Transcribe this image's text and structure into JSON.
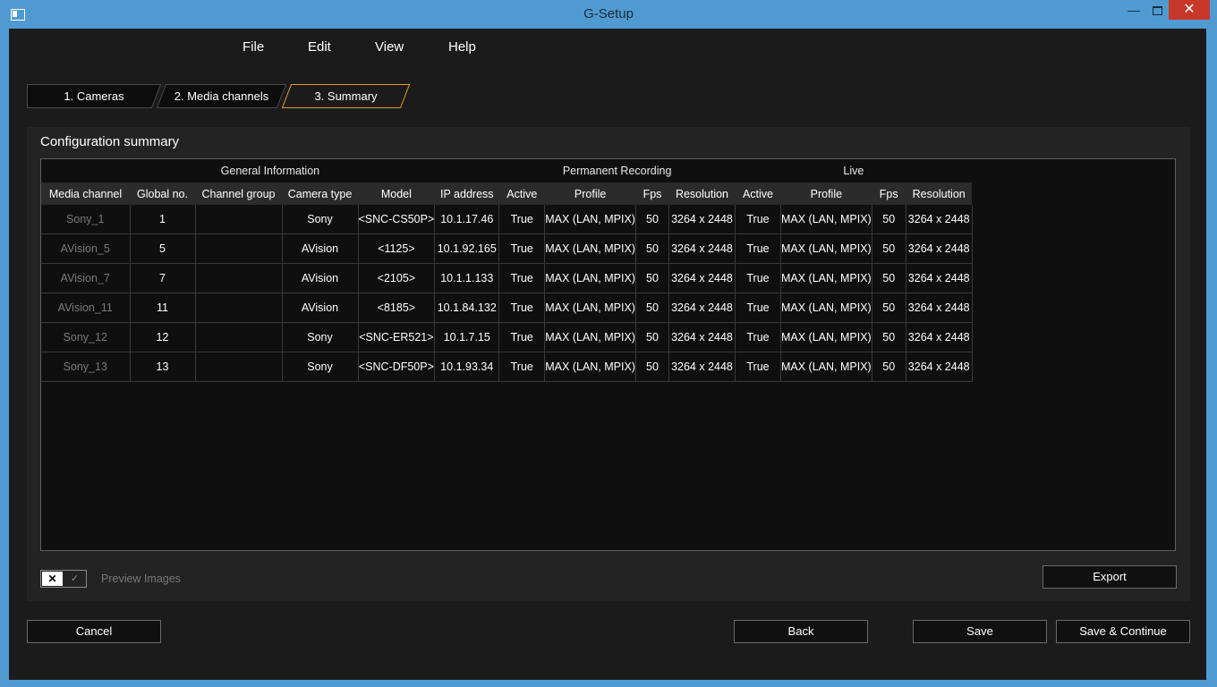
{
  "window": {
    "title": "G-Setup",
    "minimize_glyph": "—",
    "close_glyph": "✕"
  },
  "menu": {
    "file": "File",
    "edit": "Edit",
    "view": "View",
    "help": "Help"
  },
  "tabs": [
    {
      "label": "1. Cameras",
      "active": false
    },
    {
      "label": "2. Media channels",
      "active": false
    },
    {
      "label": "3. Summary",
      "active": true
    }
  ],
  "summary": {
    "title": "Configuration summary",
    "groups": {
      "general": "General Information",
      "permanent": "Permanent Recording",
      "live": "Live"
    },
    "columns": [
      "Media channel",
      "Global no.",
      "Channel group",
      "Camera type",
      "Model",
      "IP address",
      "Active",
      "Profile",
      "Fps",
      "Resolution",
      "Active",
      "Profile",
      "Fps",
      "Resolution"
    ],
    "rows": [
      [
        "Sony_1",
        "1",
        "",
        "Sony",
        "<SNC-CS50P>",
        "10.1.17.46",
        "True",
        "MAX (LAN, MPIX)",
        "50",
        "3264 x 2448",
        "True",
        "MAX (LAN, MPIX)",
        "50",
        "3264 x 2448"
      ],
      [
        "AVision_5",
        "5",
        "",
        "AVision",
        "<1125>",
        "10.1.92.165",
        "True",
        "MAX (LAN, MPIX)",
        "50",
        "3264 x 2448",
        "True",
        "MAX (LAN, MPIX)",
        "50",
        "3264 x 2448"
      ],
      [
        "AVision_7",
        "7",
        "",
        "AVision",
        "<2105>",
        "10.1.1.133",
        "True",
        "MAX (LAN, MPIX)",
        "50",
        "3264 x 2448",
        "True",
        "MAX (LAN, MPIX)",
        "50",
        "3264 x 2448"
      ],
      [
        "AVision_11",
        "11",
        "",
        "AVision",
        "<8185>",
        "10.1.84.132",
        "True",
        "MAX (LAN, MPIX)",
        "50",
        "3264 x 2448",
        "True",
        "MAX (LAN, MPIX)",
        "50",
        "3264 x 2448"
      ],
      [
        "Sony_12",
        "12",
        "",
        "Sony",
        "<SNC-ER521>",
        "10.1.7.15",
        "True",
        "MAX (LAN, MPIX)",
        "50",
        "3264 x 2448",
        "True",
        "MAX (LAN, MPIX)",
        "50",
        "3264 x 2448"
      ],
      [
        "Sony_13",
        "13",
        "",
        "Sony",
        "<SNC-DF50P>",
        "10.1.93.34",
        "True",
        "MAX (LAN, MPIX)",
        "50",
        "3264 x 2448",
        "True",
        "MAX (LAN, MPIX)",
        "50",
        "3264 x 2448"
      ]
    ],
    "preview_images": {
      "label": "Preview Images",
      "enabled": false,
      "off_glyph": "✕",
      "on_glyph": "✓"
    },
    "export_label": "Export"
  },
  "footer": {
    "cancel": "Cancel",
    "back": "Back",
    "save": "Save",
    "save_continue": "Save & Continue"
  },
  "colors": {
    "titlebar": "#4f9bd1",
    "background": "#1b1b1b",
    "active_tab_border": "#e39a2b",
    "close_button": "#c7372a"
  }
}
